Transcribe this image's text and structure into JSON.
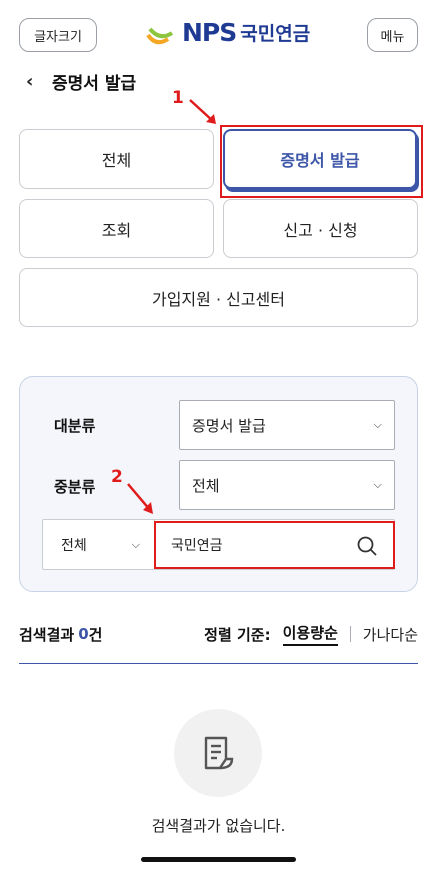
{
  "header": {
    "font_size_label": "글자크기",
    "logo_text": "NPS",
    "logo_korean": "국민연금",
    "menu_label": "메뉴"
  },
  "page": {
    "title": "증명서 발급"
  },
  "annotations": {
    "one": "1",
    "two": "2"
  },
  "categories": [
    {
      "label": "전체",
      "active": false
    },
    {
      "label": "증명서 발급",
      "active": true
    },
    {
      "label": "조회",
      "active": false
    },
    {
      "label": "신고 · 신청",
      "active": false
    },
    {
      "label": "가입지원 · 신고센터",
      "active": false
    }
  ],
  "filters": {
    "major_label": "대분류",
    "major_value": "증명서 발급",
    "minor_label": "중분류",
    "minor_value": "전체"
  },
  "search": {
    "scope": "전체",
    "query": "국민연금"
  },
  "results": {
    "label": "검색결과",
    "count": "0",
    "unit": "건",
    "sort_label": "정렬 기준:",
    "sort_active": "이용량순",
    "sort_other": "가나다순",
    "empty_message": "검색결과가 없습니다."
  },
  "colors": {
    "accent": "#3d56a8",
    "annotation": "#e01b1b"
  }
}
